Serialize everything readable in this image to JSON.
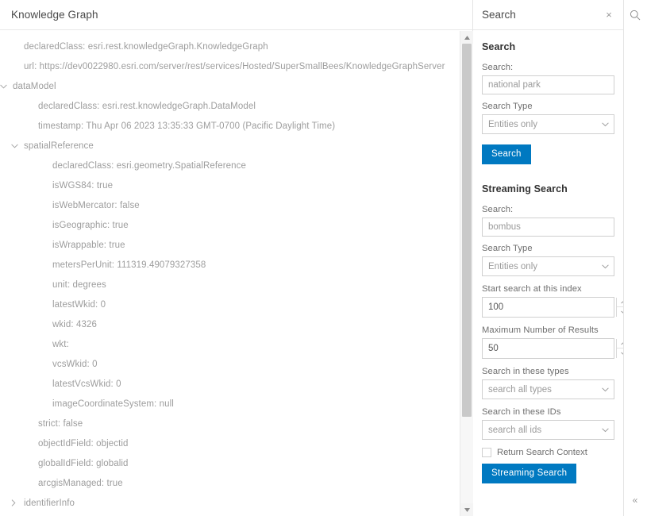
{
  "left": {
    "title": "Knowledge Graph",
    "tree": [
      {
        "indent": 1,
        "twisty": "",
        "label": "declaredClass: esri.rest.knowledgeGraph.KnowledgeGraph"
      },
      {
        "indent": 1,
        "twisty": "",
        "label": "url: https://dev0022980.esri.com/server/rest/services/Hosted/SuperSmallBees/KnowledgeGraphServer"
      },
      {
        "indent": 0,
        "twisty": "chevron-down-icon",
        "label": "dataModel"
      },
      {
        "indent": 2,
        "twisty": "",
        "label": "declaredClass: esri.rest.knowledgeGraph.DataModel"
      },
      {
        "indent": 2,
        "twisty": "",
        "label": "timestamp: Thu Apr 06 2023 13:35:33 GMT-0700 (Pacific Daylight Time)"
      },
      {
        "indent": 1,
        "twisty": "chevron-down-icon",
        "label": "spatialReference"
      },
      {
        "indent": 3,
        "twisty": "",
        "label": "declaredClass: esri.geometry.SpatialReference"
      },
      {
        "indent": 3,
        "twisty": "",
        "label": "isWGS84: true"
      },
      {
        "indent": 3,
        "twisty": "",
        "label": "isWebMercator: false"
      },
      {
        "indent": 3,
        "twisty": "",
        "label": "isGeographic: true"
      },
      {
        "indent": 3,
        "twisty": "",
        "label": "isWrappable: true"
      },
      {
        "indent": 3,
        "twisty": "",
        "label": "metersPerUnit: 111319.49079327358"
      },
      {
        "indent": 3,
        "twisty": "",
        "label": "unit: degrees"
      },
      {
        "indent": 3,
        "twisty": "",
        "label": "latestWkid: 0"
      },
      {
        "indent": 3,
        "twisty": "",
        "label": "wkid: 4326"
      },
      {
        "indent": 3,
        "twisty": "",
        "label": "wkt:"
      },
      {
        "indent": 3,
        "twisty": "",
        "label": "vcsWkid: 0"
      },
      {
        "indent": 3,
        "twisty": "",
        "label": "latestVcsWkid: 0"
      },
      {
        "indent": 3,
        "twisty": "",
        "label": "imageCoordinateSystem: null"
      },
      {
        "indent": 2,
        "twisty": "",
        "label": "strict: false"
      },
      {
        "indent": 2,
        "twisty": "",
        "label": "objectIdField: objectid"
      },
      {
        "indent": 2,
        "twisty": "",
        "label": "globalIdField: globalid"
      },
      {
        "indent": 2,
        "twisty": "",
        "label": "arcgisManaged: true"
      },
      {
        "indent": 1,
        "twisty": "chevron-right-icon",
        "label": "identifierInfo"
      }
    ]
  },
  "panel": {
    "header_title": "Search",
    "close_label": "×",
    "search_section": {
      "title": "Search",
      "search_label": "Search:",
      "search_value": "national park",
      "search_placeholder": "national park",
      "type_label": "Search Type",
      "type_value": "Entities only",
      "button_label": "Search"
    },
    "streaming_section": {
      "title": "Streaming Search",
      "search_label": "Search:",
      "search_value": "bombus",
      "search_placeholder": "bombus",
      "type_label": "Search Type",
      "type_value": "Entities only",
      "start_index_label": "Start search at this index",
      "start_index_value": "100",
      "max_results_label": "Maximum Number of Results",
      "max_results_value": "50",
      "types_label": "Search in these types",
      "types_value": "search all types",
      "ids_label": "Search in these IDs",
      "ids_value": "search all ids",
      "context_checkbox_label": "Return Search Context",
      "button_label": "Streaming Search"
    }
  },
  "rail": {
    "search_icon": "search-icon",
    "collapse_label": "«"
  },
  "colors": {
    "accent": "#0079c1",
    "text": "#4a4a4a",
    "muted": "#9a9a9a",
    "border": "#cfcfcf"
  }
}
